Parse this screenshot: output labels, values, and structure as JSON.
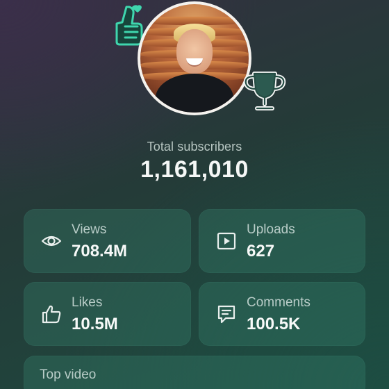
{
  "profile": {
    "subscribers_label": "Total subscribers",
    "subscribers_count": "1,161,010"
  },
  "stats": {
    "views": {
      "label": "Views",
      "value": "708.4M",
      "icon": "eye-icon"
    },
    "uploads": {
      "label": "Uploads",
      "value": "627",
      "icon": "play-icon"
    },
    "likes": {
      "label": "Likes",
      "value": "10.5M",
      "icon": "thumbs-up-icon"
    },
    "comments": {
      "label": "Comments",
      "value": "100.5K",
      "icon": "comment-icon"
    }
  },
  "top_video": {
    "label": "Top video"
  },
  "colors": {
    "sticker": "#3fd6ae",
    "card_bg": "#2f6e5e",
    "icon": "#e9efed"
  }
}
